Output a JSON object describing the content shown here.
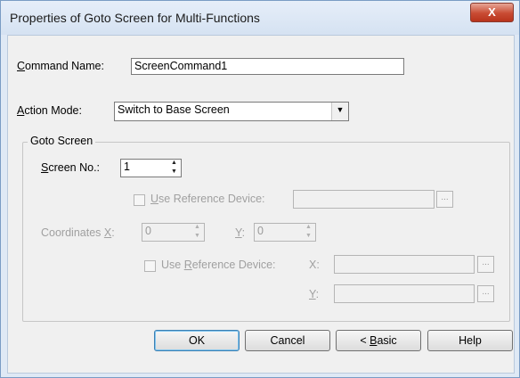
{
  "dialog": {
    "title": "Properties of Goto Screen  for Multi-Functions",
    "close_symbol": "X"
  },
  "command_name": {
    "label_u": "C",
    "label_rest": "ommand Name:",
    "value": "ScreenCommand1"
  },
  "action_mode": {
    "label_u": "A",
    "label_rest": "ction Mode:",
    "value": "Switch to Base Screen"
  },
  "goto_screen": {
    "group_label": "Goto Screen",
    "screen_no": {
      "label_u": "S",
      "label_rest": "creen No.:",
      "value": "1"
    },
    "use_ref_device_1": {
      "label_u": "U",
      "label_rest": "se Reference Device:",
      "value": "",
      "button": "..."
    },
    "coordinates": {
      "label_text": "Coordinates ",
      "label_u": "X",
      "label_colon": ":",
      "x_value": "0",
      "y_label_u": "Y",
      "y_label_colon": ":",
      "y_value": "0"
    },
    "use_ref_device_2": {
      "label_pre": "Use ",
      "label_u": "R",
      "label_rest": "eference Device:",
      "x_label": "X:",
      "x_value": "",
      "y_label_u": "Y",
      "y_label_colon": ":",
      "y_value": "",
      "button": "..."
    }
  },
  "buttons": {
    "ok": "OK",
    "cancel": "Cancel",
    "basic_prefix": "< ",
    "basic_u": "B",
    "basic_rest": "asic",
    "help": "Help"
  },
  "icons": {
    "dropdown": "chevron-down-icon",
    "spinner": "spin-arrows-icon"
  }
}
